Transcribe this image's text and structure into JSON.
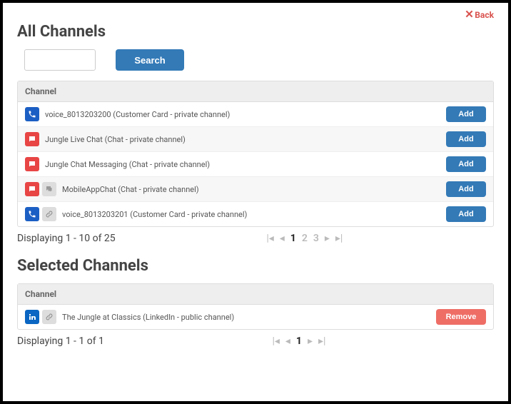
{
  "backLabel": "Back",
  "titles": {
    "all": "All Channels",
    "selected": "Selected Channels"
  },
  "search": {
    "placeholder": "",
    "buttonLabel": "Search"
  },
  "columns": {
    "channel": "Channel"
  },
  "actions": {
    "add": "Add",
    "remove": "Remove"
  },
  "allChannels": [
    {
      "iconType": "phone",
      "hasLink": false,
      "text": "voice_8013203200 (Customer Card - private channel)"
    },
    {
      "iconType": "chat",
      "hasLink": false,
      "text": "Jungle Live Chat (Chat - private channel)"
    },
    {
      "iconType": "chat",
      "hasLink": false,
      "text": "Jungle Chat Messaging (Chat - private channel)"
    },
    {
      "iconType": "chat",
      "hasLink": true,
      "text": "MobileAppChat (Chat - private channel)"
    },
    {
      "iconType": "phone",
      "hasLink": true,
      "text": "voice_8013203201 (Customer Card - private channel)"
    }
  ],
  "allPaging": {
    "displayText": "Displaying 1 - 10 of 25",
    "pages": [
      1,
      2,
      3
    ],
    "current": 1
  },
  "selectedChannels": [
    {
      "iconType": "linkedin",
      "hasLink": true,
      "text": "The Jungle at Classics (LinkedIn - public channel)"
    }
  ],
  "selectedPaging": {
    "displayText": "Displaying 1 - 1 of 1",
    "pages": [
      1
    ],
    "current": 1
  }
}
